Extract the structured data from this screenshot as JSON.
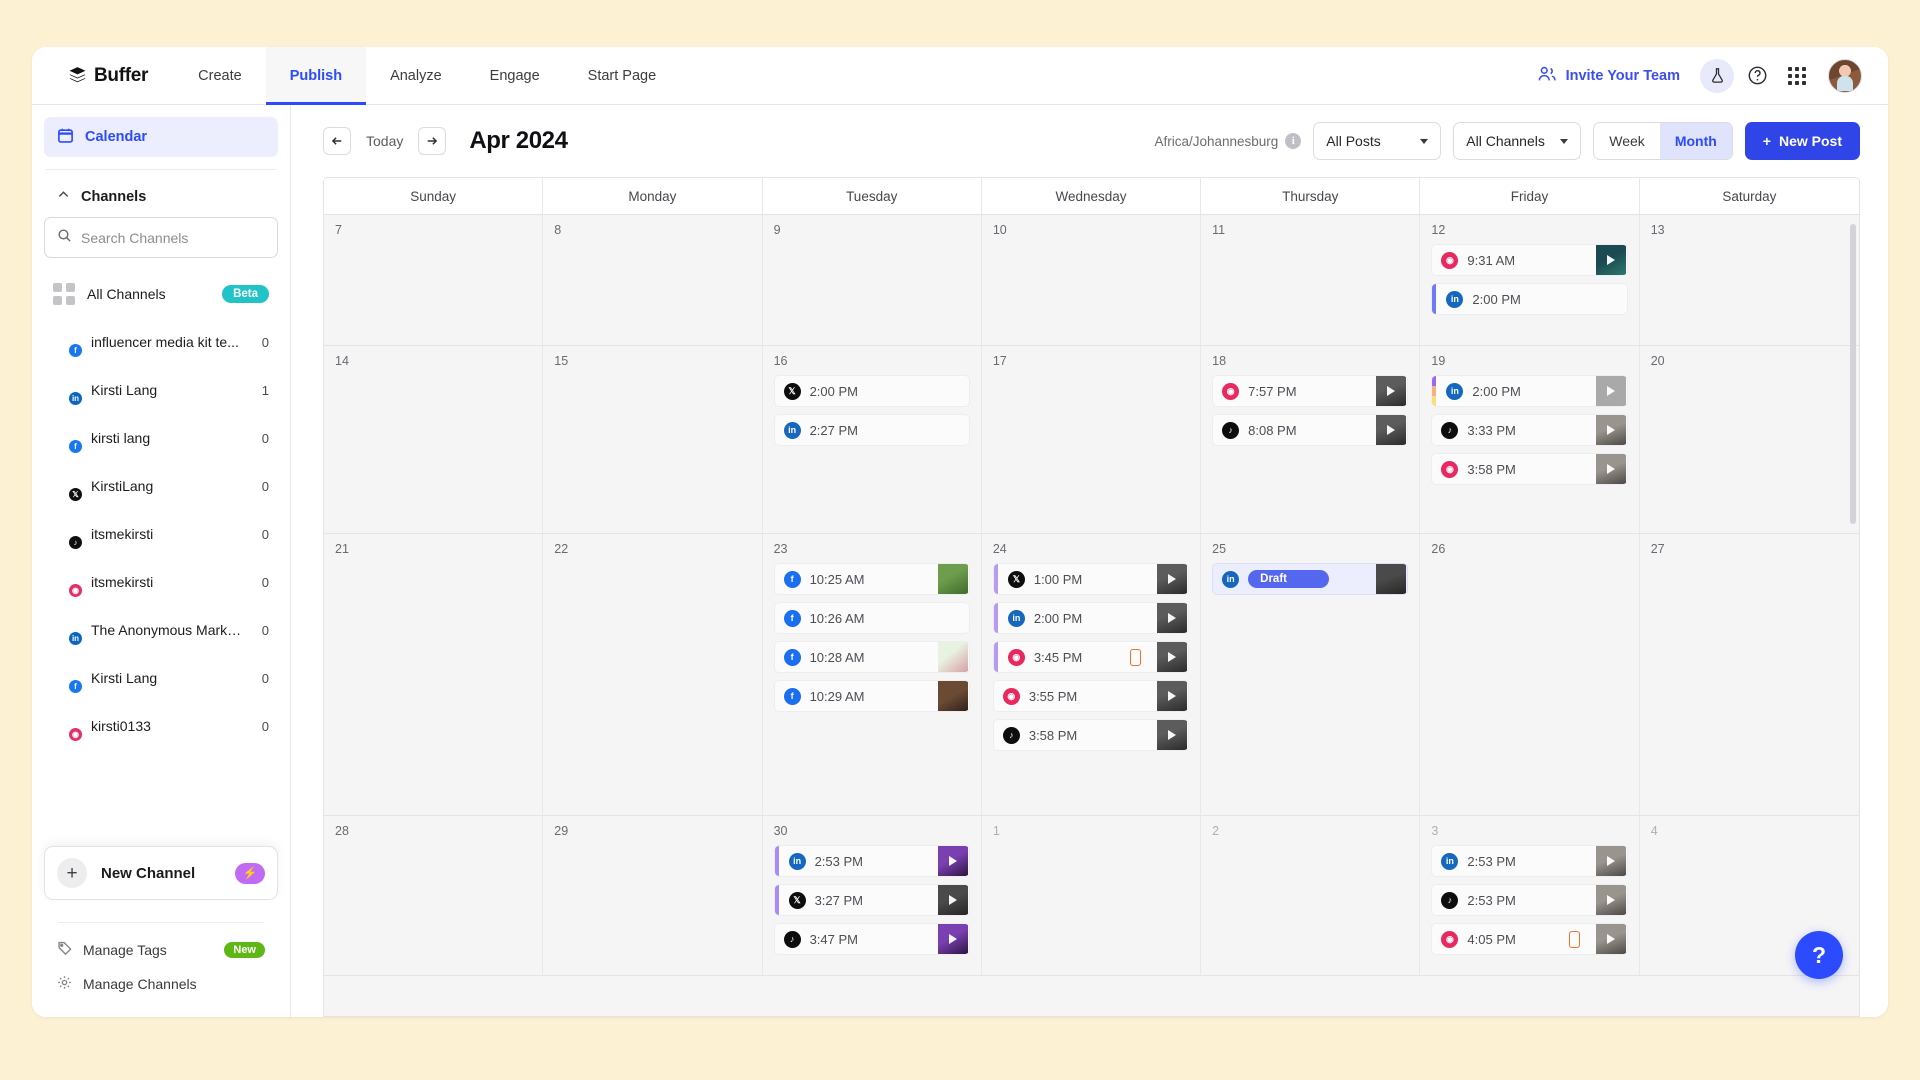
{
  "brand": {
    "name": "Buffer",
    "logo_icon": "buffer-stack-icon"
  },
  "topnav": {
    "items": [
      {
        "label": "Create",
        "active": false
      },
      {
        "label": "Publish",
        "active": true
      },
      {
        "label": "Analyze",
        "active": false
      },
      {
        "label": "Engage",
        "active": false
      },
      {
        "label": "Start Page",
        "active": false
      }
    ],
    "invite_label": "Invite Your Team",
    "icons": [
      "people-icon",
      "flask-icon",
      "help-circle-icon",
      "apps-grid-icon",
      "user-avatar"
    ]
  },
  "sidebar": {
    "calendar_label": "Calendar",
    "channels_header": "Channels",
    "search_placeholder": "Search Channels",
    "search_value": "",
    "all_channels": {
      "label": "All Channels",
      "badge": "Beta"
    },
    "channels": [
      {
        "name": "influencer media kit te...",
        "count": "0",
        "network": "facebook"
      },
      {
        "name": "Kirsti Lang",
        "count": "1",
        "network": "linkedin"
      },
      {
        "name": "kirsti lang",
        "count": "0",
        "network": "facebook"
      },
      {
        "name": "KirstiLang",
        "count": "0",
        "network": "x"
      },
      {
        "name": "itsmekirsti",
        "count": "0",
        "network": "tiktok"
      },
      {
        "name": "itsmekirsti",
        "count": "0",
        "network": "instagram"
      },
      {
        "name": "The Anonymous Marke...",
        "count": "0",
        "network": "linkedin",
        "avatar": "dark"
      },
      {
        "name": "Kirsti Lang",
        "count": "0",
        "network": "fb2",
        "avatar": "cyan"
      },
      {
        "name": "kirsti0133",
        "count": "0",
        "network": "instagram"
      }
    ],
    "new_channel": {
      "label": "New Channel",
      "icon": "plus-icon",
      "badge_icon": "bolt-icon"
    },
    "manage_tags": {
      "label": "Manage Tags",
      "badge": "New",
      "icon": "tag-icon"
    },
    "manage_channels": {
      "label": "Manage Channels",
      "icon": "gear-icon"
    }
  },
  "toolbar": {
    "prev_icon": "arrow-left-icon",
    "today_label": "Today",
    "next_icon": "arrow-right-icon",
    "month_title": "Apr 2024",
    "timezone": "Africa/Johannesburg",
    "filter_posts": "All Posts",
    "filter_channels": "All Channels",
    "view_week": "Week",
    "view_month": "Month",
    "view_active": "Month",
    "new_post_label": "New Post"
  },
  "calendar": {
    "day_headers": [
      "Sunday",
      "Monday",
      "Tuesday",
      "Wednesday",
      "Thursday",
      "Friday",
      "Saturday"
    ],
    "weeks": [
      {
        "days": [
          {
            "num": "7",
            "other": false,
            "posts": []
          },
          {
            "num": "8",
            "other": false,
            "posts": []
          },
          {
            "num": "9",
            "other": false,
            "posts": []
          },
          {
            "num": "10",
            "other": false,
            "posts": []
          },
          {
            "num": "11",
            "other": false,
            "posts": []
          },
          {
            "num": "12",
            "other": false,
            "posts": [
              {
                "time": "9:31 AM",
                "network": "instagram",
                "thumb": "teal",
                "play": true
              },
              {
                "time": "2:00 PM",
                "network": "linkedin",
                "stripe": [
                  "#6f7cf5"
                ]
              }
            ]
          },
          {
            "num": "13",
            "other": false,
            "posts": []
          }
        ]
      },
      {
        "days": [
          {
            "num": "14",
            "other": false,
            "posts": []
          },
          {
            "num": "15",
            "other": false,
            "posts": []
          },
          {
            "num": "16",
            "other": false,
            "posts": [
              {
                "time": "2:00 PM",
                "network": "x"
              },
              {
                "time": "2:27 PM",
                "network": "linkedin"
              }
            ]
          },
          {
            "num": "17",
            "other": false,
            "posts": []
          },
          {
            "num": "18",
            "other": false,
            "posts": [
              {
                "time": "7:57 PM",
                "network": "instagram",
                "thumb": "person",
                "play": true
              },
              {
                "time": "8:08 PM",
                "network": "tiktok",
                "thumb": "person",
                "play": true
              }
            ]
          },
          {
            "num": "19",
            "other": false,
            "posts": [
              {
                "time": "2:00 PM",
                "network": "linkedin",
                "stripe": [
                  "#9a6bf0",
                  "#f4b183",
                  "#f7e07a"
                ],
                "thumb": "blank",
                "play": true
              },
              {
                "time": "3:33 PM",
                "network": "tiktok",
                "thumb": "room",
                "play": true
              },
              {
                "time": "3:58 PM",
                "network": "instagram",
                "thumb": "room",
                "play": true
              }
            ]
          },
          {
            "num": "20",
            "other": false,
            "posts": []
          }
        ]
      },
      {
        "days": [
          {
            "num": "21",
            "other": false,
            "posts": []
          },
          {
            "num": "22",
            "other": false,
            "posts": []
          },
          {
            "num": "23",
            "other": false,
            "posts": [
              {
                "time": "10:25 AM",
                "network": "facebook",
                "thumb": "green"
              },
              {
                "time": "10:26 AM",
                "network": "facebook"
              },
              {
                "time": "10:28 AM",
                "network": "facebook",
                "thumb": "floral"
              },
              {
                "time": "10:29 AM",
                "network": "facebook",
                "thumb": "brown"
              }
            ]
          },
          {
            "num": "24",
            "other": false,
            "posts": [
              {
                "time": "1:00 PM",
                "network": "x",
                "stripe": [
                  "#b79bf2"
                ],
                "thumb": "person",
                "play": true
              },
              {
                "time": "2:00 PM",
                "network": "linkedin",
                "stripe": [
                  "#b79bf2"
                ],
                "thumb": "person",
                "play": true
              },
              {
                "time": "3:45 PM",
                "network": "instagram",
                "stripe": [
                  "#b79bf2"
                ],
                "mobile": true,
                "thumb": "person",
                "play": true
              },
              {
                "time": "3:55 PM",
                "network": "instagram",
                "thumb": "person",
                "play": true
              },
              {
                "time": "3:58 PM",
                "network": "tiktok",
                "thumb": "person",
                "play": true
              }
            ]
          },
          {
            "num": "25",
            "other": false,
            "posts": [
              {
                "draft_label": "Draft",
                "network": "linkedin",
                "draft": true,
                "thumb": "dark"
              }
            ]
          },
          {
            "num": "26",
            "other": false,
            "posts": []
          },
          {
            "num": "27",
            "other": false,
            "posts": []
          }
        ]
      },
      {
        "days": [
          {
            "num": "28",
            "other": false,
            "posts": []
          },
          {
            "num": "29",
            "other": false,
            "posts": []
          },
          {
            "num": "30",
            "other": false,
            "posts": [
              {
                "time": "2:53 PM",
                "network": "linkedin",
                "stripe": [
                  "#a78bfa"
                ],
                "thumb": "purple",
                "play": true
              },
              {
                "time": "3:27 PM",
                "network": "x",
                "stripe": [
                  "#a78bfa"
                ],
                "thumb": "dark",
                "play": true
              },
              {
                "time": "3:47 PM",
                "network": "tiktok",
                "thumb": "purple",
                "play": true
              }
            ]
          },
          {
            "num": "1",
            "other": true,
            "posts": []
          },
          {
            "num": "2",
            "other": true,
            "posts": []
          },
          {
            "num": "3",
            "other": true,
            "posts": [
              {
                "time": "2:53 PM",
                "network": "linkedin",
                "thumb": "room",
                "play": true
              },
              {
                "time": "2:53 PM",
                "network": "tiktok",
                "thumb": "room",
                "play": true
              },
              {
                "time": "4:05 PM",
                "network": "instagram",
                "mobile": true,
                "thumb": "room",
                "play": true
              }
            ]
          },
          {
            "num": "4",
            "other": true,
            "posts": []
          }
        ]
      }
    ]
  },
  "help_fab": {
    "label": "?",
    "icon": "help-icon"
  },
  "colors": {
    "accent": "#2c4bff",
    "page_bg": "#fdf1d4",
    "instagram": "#e8285f",
    "linkedin": "#1568bd",
    "facebook": "#1a6ef0",
    "x": "#0d0d0d",
    "tiktok": "#0d0d0d",
    "beta": "#21c3c9",
    "new": "#5fb716"
  }
}
